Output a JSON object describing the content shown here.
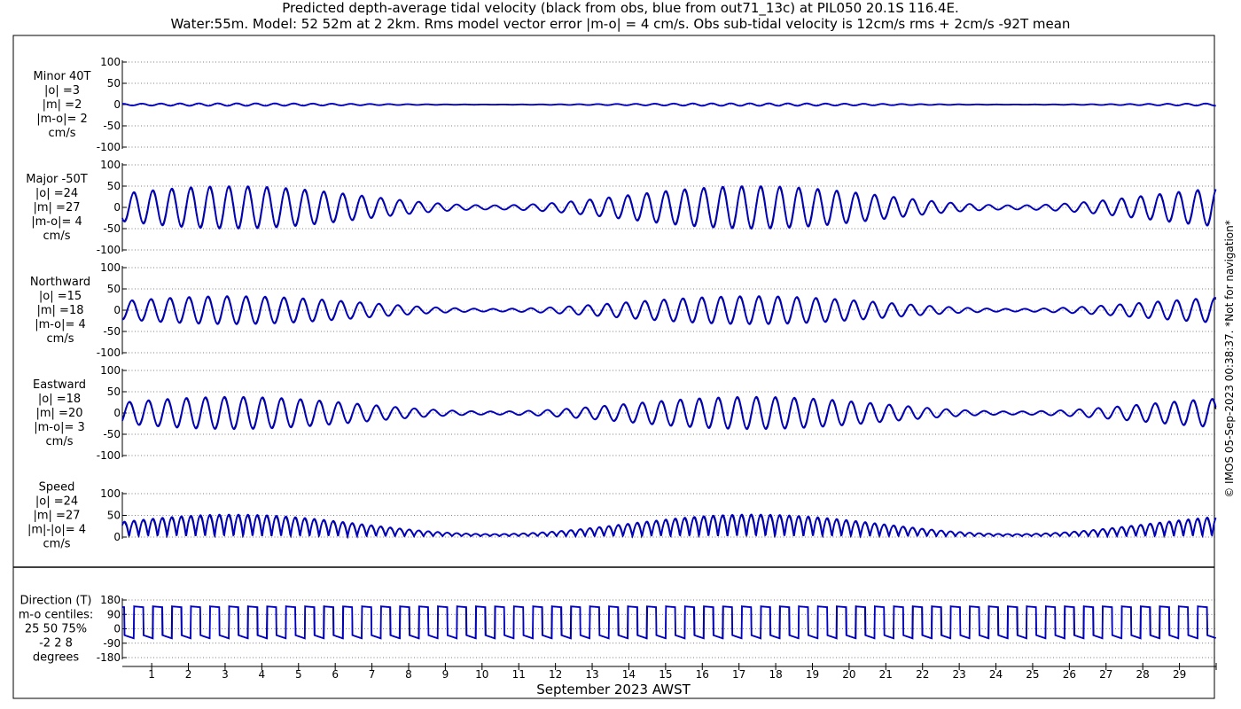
{
  "title_line1": "Predicted depth-average tidal velocity (black from obs, blue from out71_13c) at PIL050 20.1S 116.4E.",
  "title_line2": "Water:55m. Model: 52 52m at 2 2km. Rms model vector error |m-o| = 4 cm/s. Obs sub-tidal velocity is 12cm/s rms + 2cm/s -92T mean",
  "copyright": "© IMOS 05-Sep-2023 00:38:37. *Not for navigation*",
  "colors": {
    "obs": "#000000",
    "model": "#0000c8"
  },
  "chart_data": [
    {
      "type": "line",
      "panel": "minor",
      "labels": [
        "Minor 40T",
        "|o| =3",
        "|m| =2",
        "|m-o|= 2",
        "cm/s"
      ],
      "ylim": [
        -100,
        100
      ],
      "yticks": [
        "100",
        "50",
        "0",
        "-50",
        "-100"
      ],
      "grid": true,
      "amplitude": 3
    },
    {
      "type": "line",
      "panel": "major",
      "labels": [
        "Major -50T",
        "|o| =24",
        "|m| =27",
        "|m-o|= 4",
        "cm/s"
      ],
      "ylim": [
        -100,
        100
      ],
      "yticks": [
        "100",
        "50",
        "0",
        "-50",
        "-100"
      ],
      "grid": true,
      "amplitude": 50
    },
    {
      "type": "line",
      "panel": "north",
      "labels": [
        "Northward",
        "|o| =15",
        "|m| =18",
        "|m-o|= 4",
        "cm/s"
      ],
      "ylim": [
        -100,
        100
      ],
      "yticks": [
        "100",
        "50",
        "0",
        "-50",
        "-100"
      ],
      "grid": true,
      "amplitude": 33
    },
    {
      "type": "line",
      "panel": "east",
      "labels": [
        "Eastward",
        "|o| =18",
        "|m| =20",
        "|m-o|= 3",
        "cm/s"
      ],
      "ylim": [
        -100,
        100
      ],
      "yticks": [
        "100",
        "50",
        "0",
        "-50",
        "-100"
      ],
      "grid": true,
      "amplitude": 38
    },
    {
      "type": "line",
      "panel": "speed",
      "labels": [
        "Speed",
        "|o| =24",
        "|m| =27",
        "|m|-|o|= 4",
        "cm/s"
      ],
      "ylim": [
        0,
        100
      ],
      "yticks": [
        "100",
        "50",
        "0"
      ],
      "grid": true,
      "amplitude": 50
    },
    {
      "type": "line",
      "panel": "direction",
      "labels": [
        "Direction (T)",
        "m-o centiles:",
        "25  50  75%",
        "-2  2  8",
        "degrees"
      ],
      "ylim": [
        -180,
        180
      ],
      "yticks": [
        "180",
        "90",
        "0",
        "-90",
        "-180"
      ],
      "grid": true
    }
  ],
  "x_axis": {
    "label": "September 2023 AWST",
    "days": [
      "1",
      "2",
      "3",
      "4",
      "5",
      "6",
      "7",
      "8",
      "9",
      "10",
      "11",
      "12",
      "13",
      "14",
      "15",
      "16",
      "17",
      "18",
      "19",
      "20",
      "21",
      "22",
      "23",
      "24",
      "25",
      "26",
      "27",
      "28",
      "29"
    ]
  }
}
